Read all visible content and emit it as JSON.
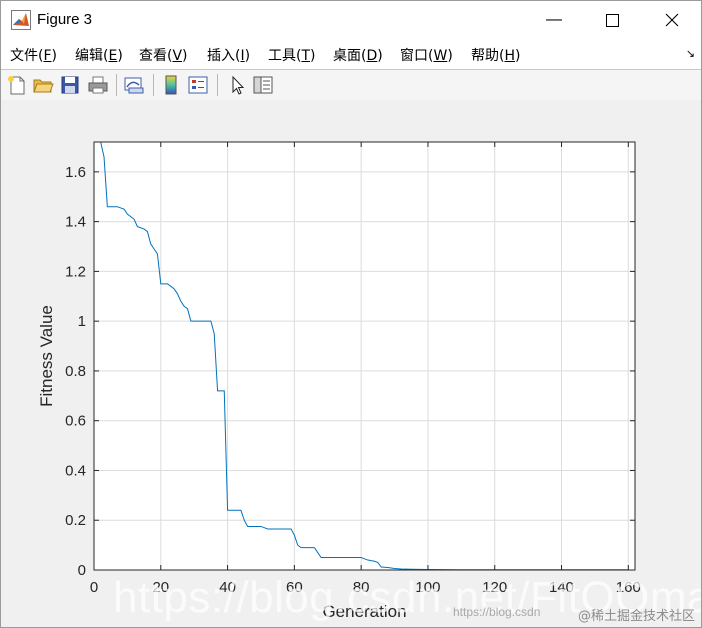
{
  "window": {
    "title": "Figure 3",
    "minimize_glyph": "—",
    "maximize_glyph": "☐",
    "close_glyph": "✕"
  },
  "menu": {
    "items": [
      {
        "label": "文件(",
        "key": "F",
        "suffix": ")"
      },
      {
        "label": "编辑(",
        "key": "E",
        "suffix": ")"
      },
      {
        "label": "查看(",
        "key": "V",
        "suffix": ")"
      },
      {
        "label": "插入(",
        "key": "I",
        "suffix": ")"
      },
      {
        "label": "工具(",
        "key": "T",
        "suffix": ")"
      },
      {
        "label": "桌面(",
        "key": "D",
        "suffix": ")"
      },
      {
        "label": "窗口(",
        "key": "W",
        "suffix": ")"
      },
      {
        "label": "帮助(",
        "key": "H",
        "suffix": ")"
      }
    ],
    "dock_glyph": "↘"
  },
  "toolbar": {
    "icons": [
      "new-figure-icon",
      "open-file-icon",
      "save-icon",
      "print-icon",
      "link-plot-icon",
      "colorbar-icon",
      "legend-icon",
      "pointer-icon",
      "property-inspector-icon"
    ]
  },
  "colors": {
    "line": "#0072bd",
    "grid": "#dcdcdc",
    "axis": "#262626"
  },
  "chart_data": {
    "type": "line",
    "title": "",
    "xlabel": "Generation",
    "ylabel": "Fitness Value",
    "xlim": [
      0,
      162
    ],
    "ylim": [
      0,
      1.72
    ],
    "xticks": [
      0,
      20,
      40,
      60,
      80,
      100,
      120,
      140,
      160
    ],
    "xtick_labels": [
      "0",
      "20",
      "40",
      "60",
      "80",
      "100",
      "120",
      "140",
      "160"
    ],
    "yticks": [
      0,
      0.2,
      0.4,
      0.6,
      0.8,
      1,
      1.2,
      1.4,
      1.6
    ],
    "ytick_labels": [
      "0",
      "0.2",
      "0.4",
      "0.6",
      "0.8",
      "1",
      "1.2",
      "1.4",
      "1.6"
    ],
    "grid": true,
    "series": [
      {
        "x": [
          2,
          3,
          4,
          7,
          9,
          10,
          12,
          13,
          15,
          16,
          17,
          18,
          19,
          20,
          22,
          23,
          24,
          25,
          26,
          27,
          28,
          29,
          30,
          31,
          32,
          33,
          34,
          35,
          36,
          37,
          38,
          39,
          40,
          41,
          42,
          43,
          44,
          45,
          46,
          47,
          48,
          49,
          50,
          51,
          52,
          53,
          55,
          57,
          59,
          60,
          61,
          62,
          63,
          64,
          65,
          66,
          67,
          68,
          70,
          75,
          80,
          81,
          82,
          84,
          85,
          86,
          88,
          90,
          92,
          95,
          100,
          110,
          120,
          140,
          160
        ],
        "y": [
          1.72,
          1.66,
          1.46,
          1.46,
          1.45,
          1.43,
          1.41,
          1.38,
          1.37,
          1.36,
          1.31,
          1.29,
          1.27,
          1.15,
          1.15,
          1.14,
          1.13,
          1.11,
          1.08,
          1.06,
          1.05,
          1.0,
          1.0,
          1.0,
          1.0,
          1.0,
          1.0,
          1.0,
          0.95,
          0.72,
          0.72,
          0.72,
          0.24,
          0.24,
          0.24,
          0.24,
          0.24,
          0.2,
          0.175,
          0.175,
          0.175,
          0.175,
          0.175,
          0.17,
          0.165,
          0.165,
          0.165,
          0.165,
          0.165,
          0.14,
          0.1,
          0.09,
          0.09,
          0.09,
          0.09,
          0.09,
          0.07,
          0.05,
          0.05,
          0.05,
          0.05,
          0.045,
          0.04,
          0.035,
          0.03,
          0.012,
          0.01,
          0.006,
          0.004,
          0.003,
          0.002,
          0.001,
          0.001,
          0.001,
          0.001
        ]
      }
    ]
  },
  "watermark": {
    "main": "https://blog.csdn.net/FitQOmatlab",
    "secondary": "https://blog.csdn",
    "site": "@稀土掘金技术社区"
  }
}
